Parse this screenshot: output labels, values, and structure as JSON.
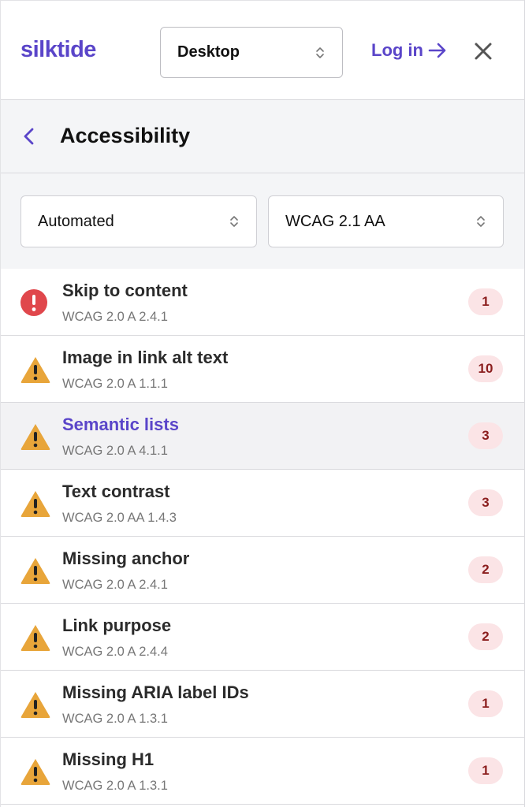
{
  "header": {
    "logo": "silktide",
    "device_value": "Desktop",
    "login_label": "Log in",
    "brand_color": "#5a45c9"
  },
  "section": {
    "title": "Accessibility"
  },
  "filters": {
    "mode_value": "Automated",
    "standard_value": "WCAG 2.1 AA"
  },
  "issues": [
    {
      "title": "Skip to content",
      "ref": "WCAG 2.0 A 2.4.1",
      "count": "1",
      "severity": "error",
      "icon": "error-circle-icon"
    },
    {
      "title": "Image in link alt text",
      "ref": "WCAG 2.0 A 1.1.1",
      "count": "10",
      "severity": "warning",
      "icon": "warning-triangle-icon"
    },
    {
      "title": "Semantic lists",
      "ref": "WCAG 2.0 A 4.1.1",
      "count": "3",
      "severity": "warning",
      "icon": "warning-triangle-icon",
      "selected": true
    },
    {
      "title": "Text contrast",
      "ref": "WCAG 2.0 AA 1.4.3",
      "count": "3",
      "severity": "warning",
      "icon": "warning-triangle-icon"
    },
    {
      "title": "Missing anchor",
      "ref": "WCAG 2.0 A 2.4.1",
      "count": "2",
      "severity": "warning",
      "icon": "warning-triangle-icon"
    },
    {
      "title": "Link purpose",
      "ref": "WCAG 2.0 A 2.4.4",
      "count": "2",
      "severity": "warning",
      "icon": "warning-triangle-icon"
    },
    {
      "title": "Missing ARIA label IDs",
      "ref": "WCAG 2.0 A 1.3.1",
      "count": "1",
      "severity": "warning",
      "icon": "warning-triangle-icon"
    },
    {
      "title": "Missing H1",
      "ref": "WCAG 2.0 A 1.3.1",
      "count": "1",
      "severity": "warning",
      "icon": "warning-triangle-icon"
    }
  ],
  "colors": {
    "error": "#e0474c",
    "warning": "#e8a53a",
    "badge_bg": "#fbe4e6",
    "badge_text": "#8b1e1e"
  }
}
